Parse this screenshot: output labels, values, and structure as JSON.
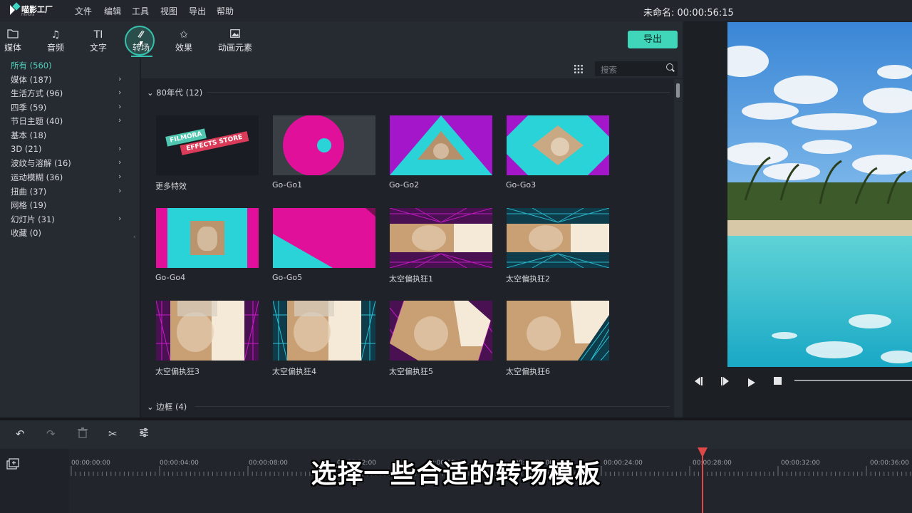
{
  "app": {
    "logo_text": "喵影工厂",
    "logo_sub": "Filmora"
  },
  "menu": [
    "文件",
    "编辑",
    "工具",
    "视图",
    "导出",
    "帮助"
  ],
  "project": {
    "label": "未命名: 00:00:56:15"
  },
  "tabs": [
    {
      "label": "媒体",
      "icon": "folder-icon"
    },
    {
      "label": "音频",
      "icon": "music-note-icon"
    },
    {
      "label": "文字",
      "icon": "text-icon"
    },
    {
      "label": "转场",
      "icon": "transition-icon"
    },
    {
      "label": "效果",
      "icon": "effects-icon"
    },
    {
      "label": "动画元素",
      "icon": "image-icon"
    }
  ],
  "export_label": "导出",
  "categories": [
    {
      "label": "所有 (560)",
      "active": true,
      "has_children": false
    },
    {
      "label": "媒体 (187)",
      "has_children": true
    },
    {
      "label": "生活方式 (96)",
      "has_children": true
    },
    {
      "label": "四季 (59)",
      "has_children": true
    },
    {
      "label": "节日主题 (40)",
      "has_children": true
    },
    {
      "label": "基本 (18)",
      "has_children": false
    },
    {
      "label": "3D (21)",
      "has_children": true
    },
    {
      "label": "波纹与溶解 (16)",
      "has_children": true
    },
    {
      "label": "运动模糊 (36)",
      "has_children": true
    },
    {
      "label": "扭曲 (37)",
      "has_children": true
    },
    {
      "label": "网格 (19)",
      "has_children": false
    },
    {
      "label": "幻灯片 (31)",
      "has_children": true
    },
    {
      "label": "收藏 (0)",
      "has_children": false
    }
  ],
  "search": {
    "placeholder": "搜索"
  },
  "sections": [
    {
      "title": "80年代 (12)",
      "expanded": true
    },
    {
      "title": "边框 (4)",
      "expanded": true
    }
  ],
  "store_tile": {
    "line1": "FILMORA",
    "line2": "EFFECTS STORE"
  },
  "tiles": [
    {
      "label": "更多特效",
      "kind": "store"
    },
    {
      "label": "Go-Go1",
      "kind": "gogo1"
    },
    {
      "label": "Go-Go2",
      "kind": "gogo2"
    },
    {
      "label": "Go-Go3",
      "kind": "gogo3"
    },
    {
      "label": "Go-Go4",
      "kind": "gogo4"
    },
    {
      "label": "Go-Go5",
      "kind": "gogo5"
    },
    {
      "label": "太空偏执狂1",
      "kind": "space1"
    },
    {
      "label": "太空偏执狂2",
      "kind": "space2"
    },
    {
      "label": "太空偏执狂3",
      "kind": "space3"
    },
    {
      "label": "太空偏执狂4",
      "kind": "space4"
    },
    {
      "label": "太空偏执狂5",
      "kind": "space5"
    },
    {
      "label": "太空偏执狂6",
      "kind": "space6"
    }
  ],
  "timeline": {
    "ticks": [
      "00:00:00:00",
      "00:00:04:00",
      "00:00:08:00",
      "00:00:12:00",
      "00:00:16:00",
      "00:00:20:00",
      "00:00:24:00",
      "00:00:28:00",
      "00:00:32:00",
      "00:00:36:00"
    ],
    "subtitle": "选择一些合适的转场模板"
  },
  "colors": {
    "accent": "#3fd6b9",
    "magenta": "#e0109a",
    "cyan": "#29d3d8",
    "purple": "#a316c9",
    "playhead": "#e04848"
  }
}
